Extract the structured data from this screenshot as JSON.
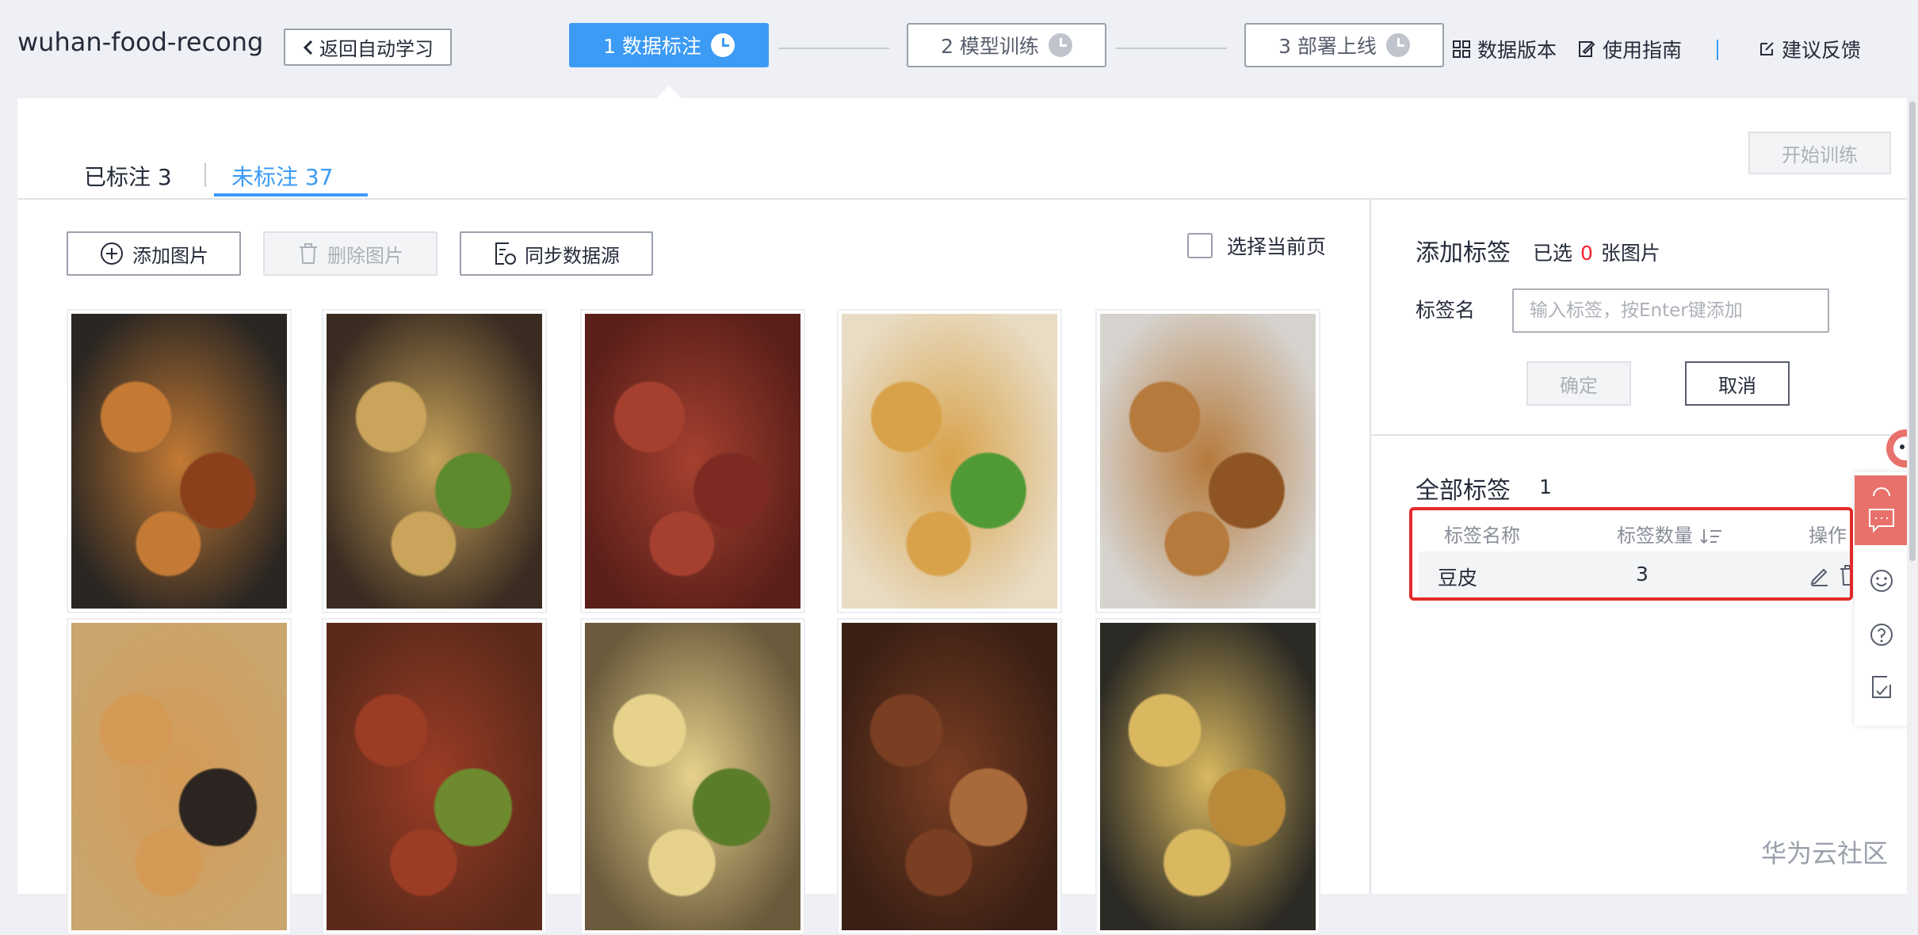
{
  "header": {
    "app_title": "wuhan-food-recong",
    "back_label": "返回自动学习",
    "steps": [
      {
        "label": "1 数据标注",
        "state": "active"
      },
      {
        "label": "2 模型训练",
        "state": "idle"
      },
      {
        "label": "3 部署上线",
        "state": "idle"
      }
    ],
    "links": {
      "data_version": "数据版本",
      "user_guide": "使用指南",
      "feedback": "建议反馈"
    }
  },
  "tabs": {
    "labeled": "已标注 3",
    "unlabeled": "未标注 37",
    "active": "unlabeled"
  },
  "actions": {
    "start_training": "开始训练",
    "add_image": "添加图片",
    "delete_image": "删除图片",
    "sync_source": "同步数据源",
    "select_current_page": "选择当前页"
  },
  "images": [
    {
      "icon": "fried-dough-rings-photo"
    },
    {
      "icon": "hot-dry-noodles-photo"
    },
    {
      "icon": "braised-duck-neck-photo"
    },
    {
      "icon": "noodles-with-scallions-photo"
    },
    {
      "icon": "fried-rice-rings-photo"
    },
    {
      "icon": "sesame-donuts-photo"
    },
    {
      "icon": "braised-meat-photo"
    },
    {
      "icon": "doupi-sticky-rice-photo"
    },
    {
      "icon": "braised-chunks-photo"
    },
    {
      "icon": "pan-fried-bread-photo"
    }
  ],
  "add_tag": {
    "title": "添加标签",
    "selected_prefix": "已选",
    "selected_count": "0",
    "selected_suffix": "张图片",
    "label_name": "标签名",
    "input_placeholder": "输入标签，按Enter键添加",
    "confirm": "确定",
    "cancel": "取消"
  },
  "all_tags": {
    "title": "全部标签",
    "count": "1",
    "columns": {
      "name": "标签名称",
      "quantity": "标签数量",
      "operation": "操作"
    },
    "rows": [
      {
        "name": "豆皮",
        "quantity": "3"
      }
    ]
  },
  "watermark": "华为云社区",
  "colors": {
    "accent": "#3c9bf5",
    "highlight_border": "#e52a2a",
    "selected_count": "#f5222d",
    "float_panel": "#e8716b"
  }
}
